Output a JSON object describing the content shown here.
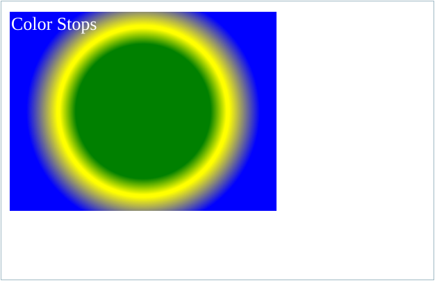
{
  "demo": {
    "title": "Color Stops",
    "colors": {
      "inner": "#008000",
      "middle": "#ffff00",
      "outer": "#0000ff",
      "text": "#ffffff",
      "frame_border": "#9fb9c4",
      "page_background": "#ffffff"
    }
  }
}
